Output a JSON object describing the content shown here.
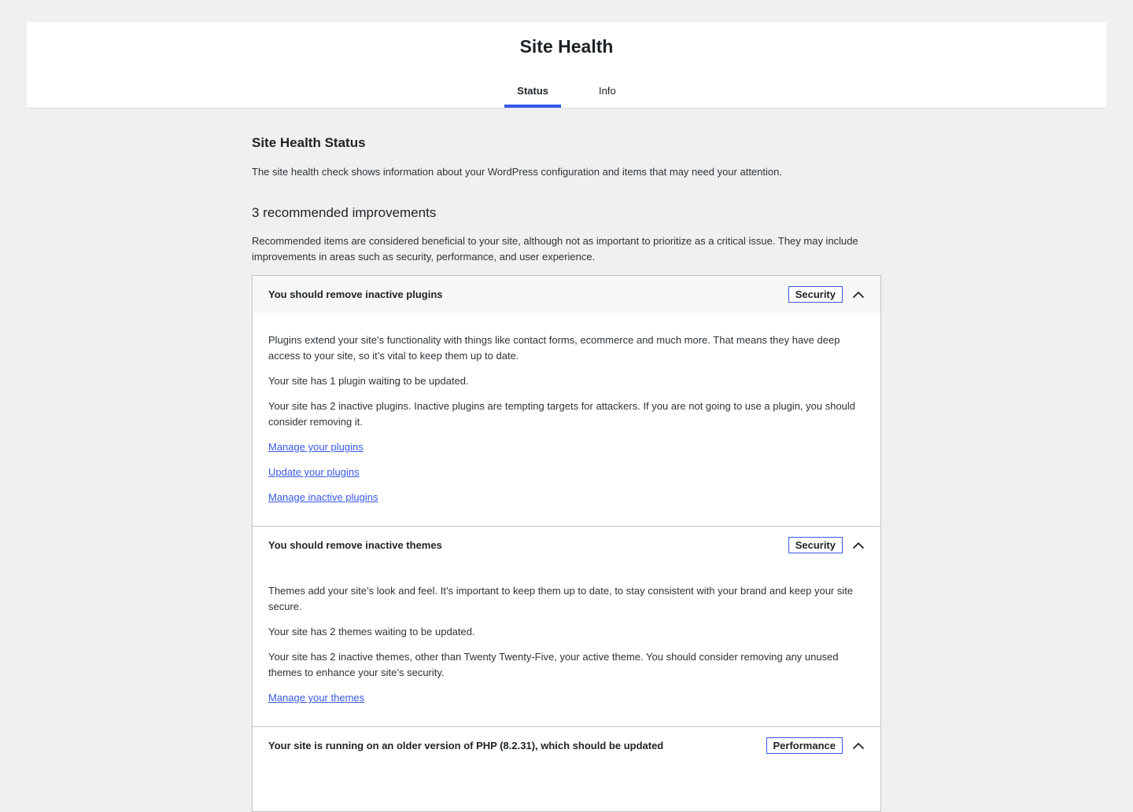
{
  "header": {
    "title": "Site Health",
    "tabs": [
      {
        "label": "Status",
        "active": true
      },
      {
        "label": "Info",
        "active": false
      }
    ]
  },
  "status": {
    "title": "Site Health Status",
    "description": "The site health check shows information about your WordPress configuration and items that may need your attention."
  },
  "improvements": {
    "title": "3 recommended improvements",
    "description": "Recommended items are considered beneficial to your site, although not as important to prioritize as a critical issue. They may include improvements in areas such as security, performance, and user experience.",
    "items": [
      {
        "title": "You should remove inactive plugins",
        "badge": "Security",
        "paragraphs": [
          "Plugins extend your site’s functionality with things like contact forms, ecommerce and much more. That means they have deep access to your site, so it’s vital to keep them up to date.",
          "Your site has 1 plugin waiting to be updated.",
          "Your site has 2 inactive plugins. Inactive plugins are tempting targets for attackers. If you are not going to use a plugin, you should consider removing it."
        ],
        "links": [
          "Manage your plugins",
          "Update your plugins",
          "Manage inactive plugins"
        ]
      },
      {
        "title": "You should remove inactive themes",
        "badge": "Security",
        "paragraphs": [
          "Themes add your site’s look and feel. It’s important to keep them up to date, to stay consistent with your brand and keep your site secure.",
          "Your site has 2 themes waiting to be updated.",
          "Your site has 2 inactive themes, other than Twenty Twenty-Five, your active theme. You should consider removing any unused themes to enhance your site’s security."
        ],
        "links": [
          "Manage your themes"
        ]
      },
      {
        "title": "Your site is running on an older version of PHP (8.2.31), which should be updated",
        "badge": "Performance",
        "paragraphs": [],
        "links": []
      }
    ]
  },
  "colors": {
    "accent": "#3858e9",
    "background": "#f0f0f1"
  },
  "icons": {
    "chevron": "chevron-up-icon"
  }
}
